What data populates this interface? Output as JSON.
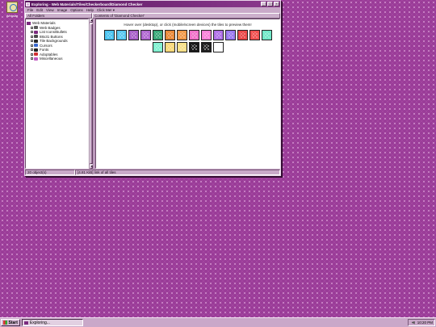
{
  "desktop": {
    "icon_label": "Website"
  },
  "window": {
    "title": "Exploring - Web Materials/Tiles/Checkerboard/Diamond Checker",
    "buttons": {
      "minimize": "_",
      "maximize": "□",
      "close": "×"
    },
    "menu": [
      "File",
      "Edit",
      "View",
      "Image",
      "Options",
      "Help",
      "Click Me! ▾"
    ],
    "left_header": "All Folders",
    "right_header": "Contents of 'Diamond Checker'",
    "tree": {
      "root": "Web Materials",
      "items": [
        {
          "label": "Web Badges",
          "color": "#5a5a5a"
        },
        {
          "label": "List Icons/Bullets",
          "color": "#7b2a7e"
        },
        {
          "label": "88x31 Buttons",
          "color": "#4a4a4a"
        },
        {
          "label": "Tile Backgrounds",
          "color": "#2a2a2a"
        },
        {
          "label": "Cursors",
          "color": "#3a6ad0"
        },
        {
          "label": "Fonts",
          "color": "#222222"
        },
        {
          "label": "Adoptables",
          "color": "#d03030"
        },
        {
          "label": "Miscellaneous",
          "color": "#c05ac0"
        }
      ]
    },
    "instruction": "Hover over (desktop), or click (mobile/screen devices) the tiles to preview them!",
    "tiles": [
      {
        "color": "#4cc4f0"
      },
      {
        "color": "#58c8f0"
      },
      {
        "color": "#a860c8"
      },
      {
        "color": "#b068d0"
      },
      {
        "color": "#3aa878"
      },
      {
        "color": "#e88838"
      },
      {
        "color": "#f09848"
      },
      {
        "color": "#f070c8"
      },
      {
        "color": "#f880d8"
      },
      {
        "color": "#b070e8"
      },
      {
        "color": "#9a78f0"
      },
      {
        "color": "#e84848"
      },
      {
        "color": "#f05050"
      },
      {
        "color": "#70e8c8"
      },
      {
        "color": "#80f0d0"
      },
      {
        "color": "#f8d878"
      },
      {
        "color": "#f8e088"
      },
      {
        "color": "#181818",
        "dark": true
      },
      {
        "color": "#202020",
        "dark": true
      },
      {
        "color": "#ffffff"
      }
    ],
    "status_left": "20 object(s)",
    "status_right": "[4.81 KiB] link of all tiles"
  },
  "taskbar": {
    "start_label": "Start",
    "task_label": "Exploring...",
    "clock": "10:20 PM"
  }
}
